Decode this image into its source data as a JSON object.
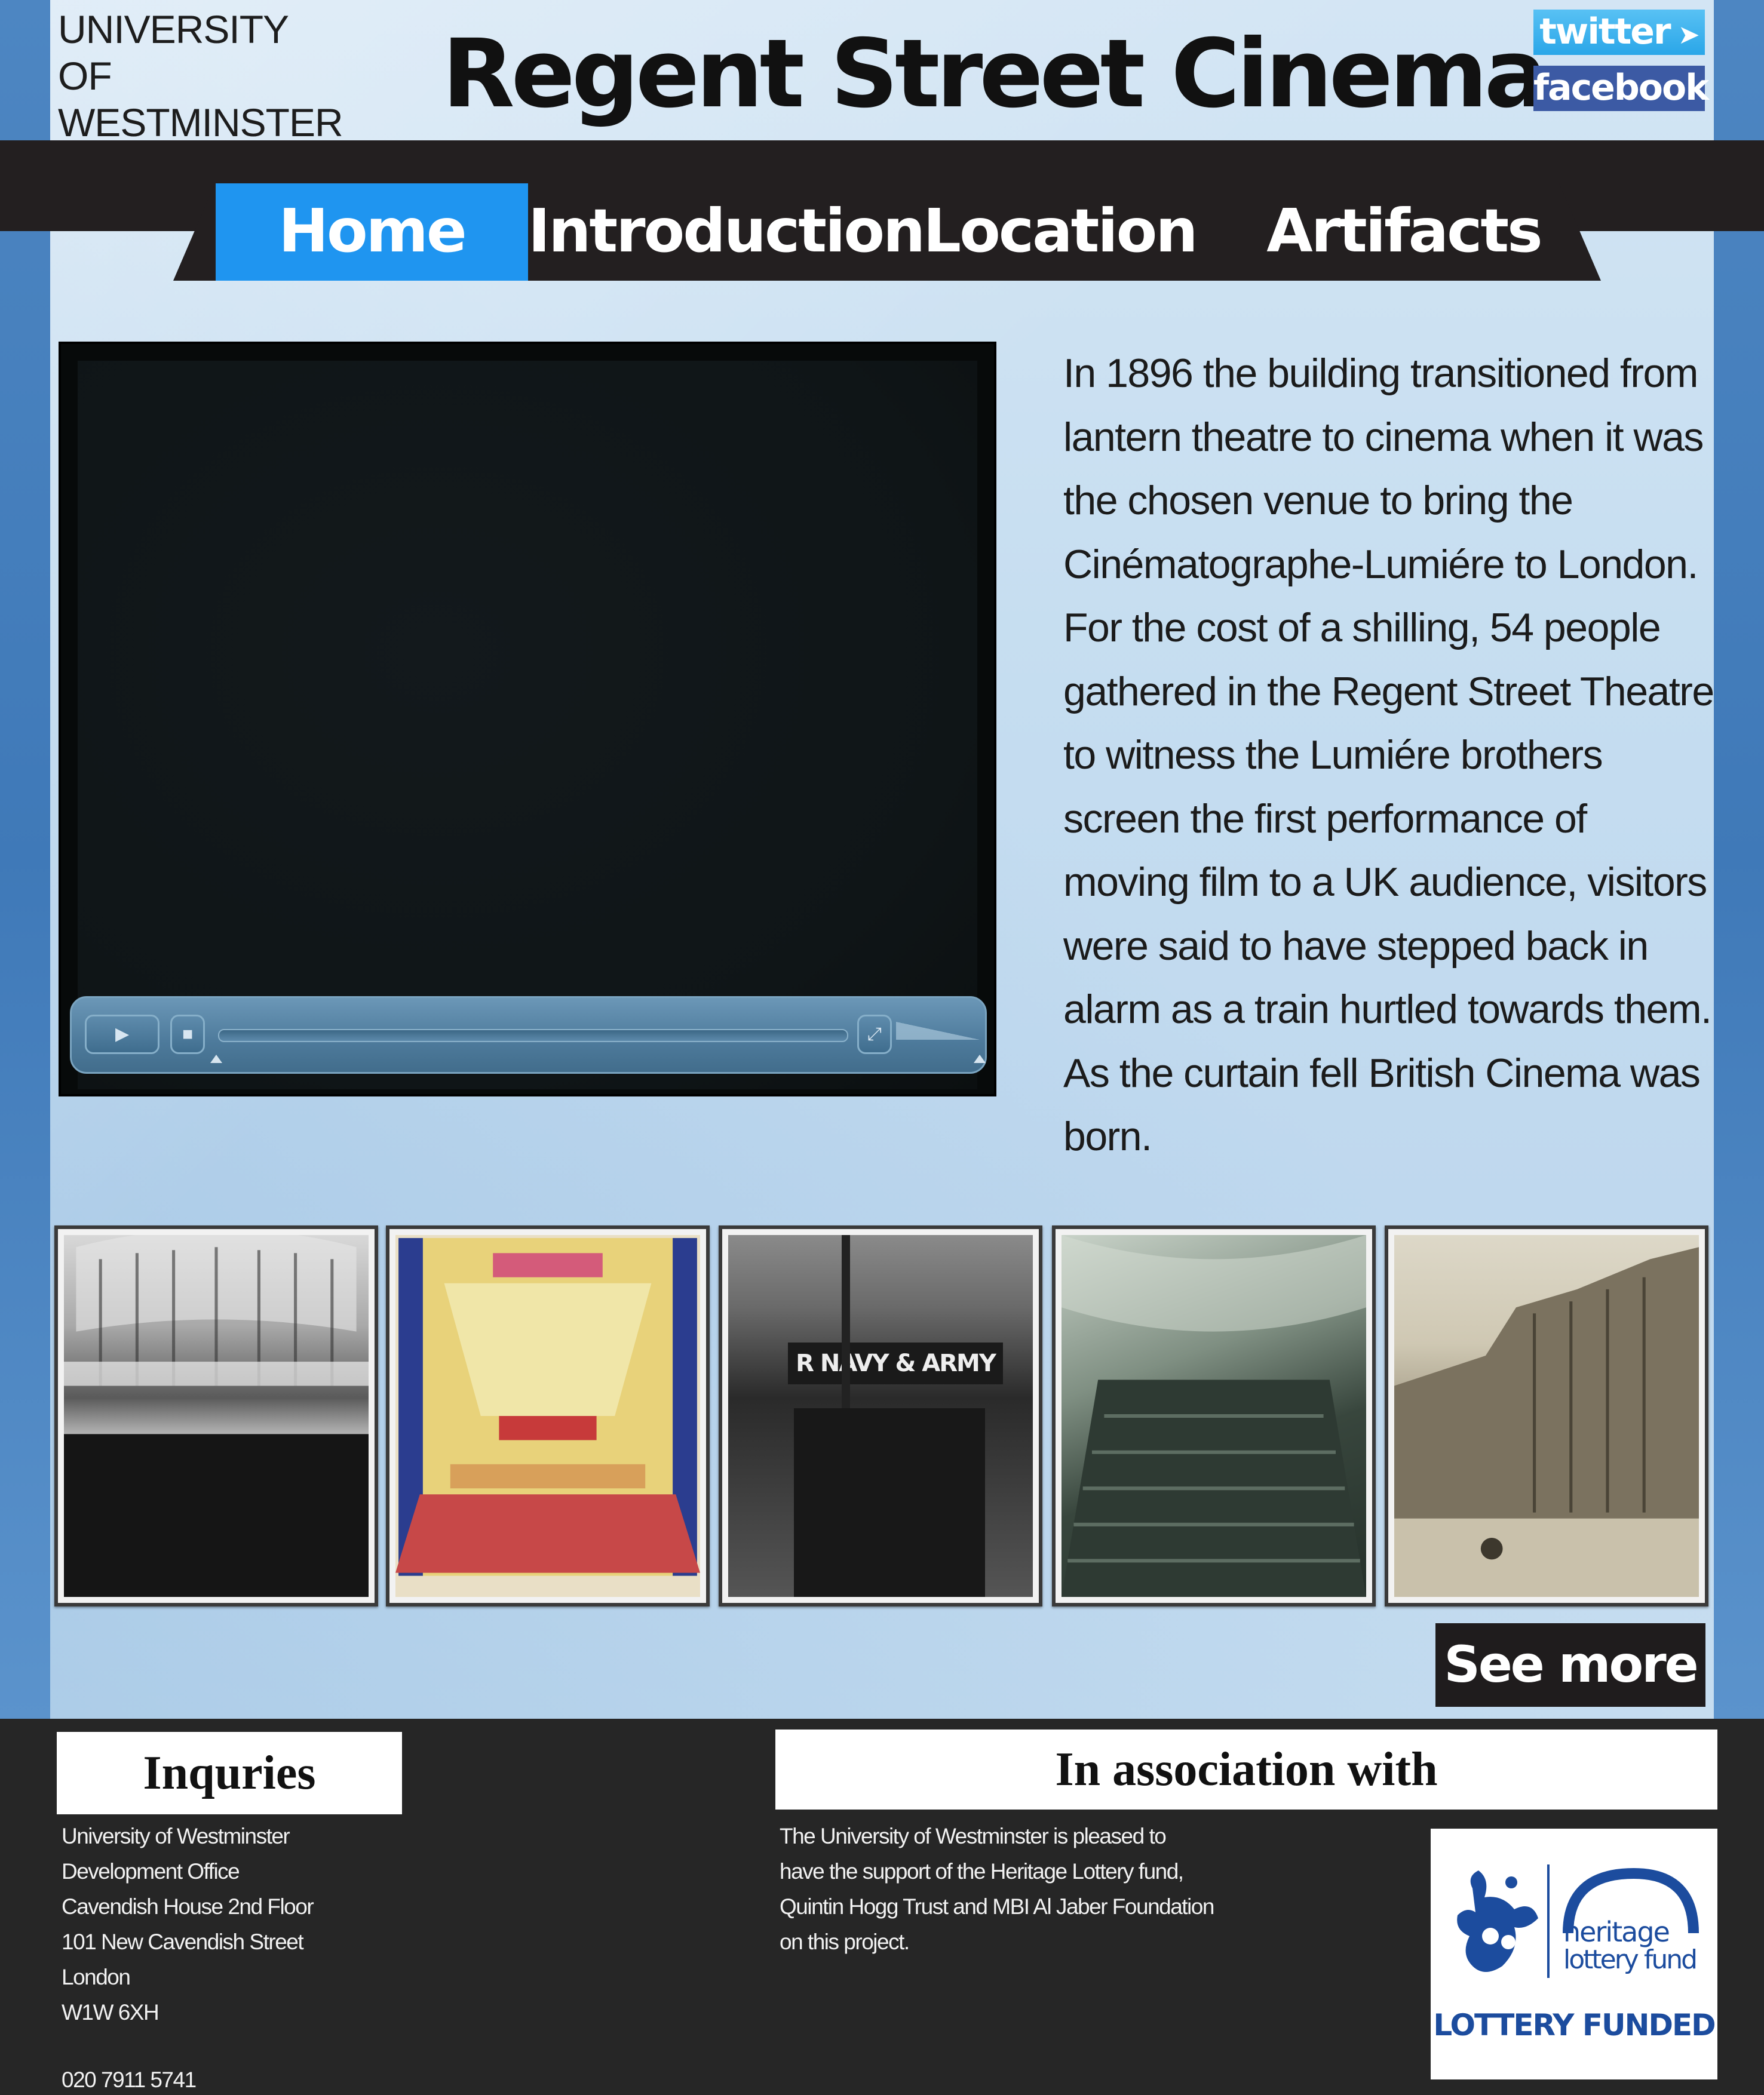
{
  "header": {
    "university_line1": "UNIVERSITY OF",
    "university_line2": "WESTMINSTER",
    "site_title": "Regent Street Cinema",
    "social_twitter": "twitter",
    "social_facebook": "facebook"
  },
  "nav": {
    "items": [
      {
        "label": "Home",
        "active": true
      },
      {
        "label": "Introduction",
        "active": false
      },
      {
        "label": "Location",
        "active": false
      },
      {
        "label": "Artifacts",
        "active": false
      }
    ]
  },
  "main": {
    "intro_lines": [
      "In 1896 the building transitioned from",
      "lantern theatre to cinema when it was",
      "the chosen venue to bring the",
      "Cinématographe-Lumiére to London.",
      "For the cost of a shilling, 54 people",
      "gathered in the Regent Street Theatre",
      "to witness the Lumiére brothers",
      "screen the first performance of",
      "moving film to a UK audience, visitors",
      "were said to have stepped back in",
      "alarm as a train hurtled towards them.",
      "As the curtain fell British Cinema was",
      "born."
    ],
    "video_progress": 0
  },
  "gallery": {
    "thumb3_sign": "R NAVY & ARMY",
    "see_more": "See more >"
  },
  "footer": {
    "inquiries_title": "Inquries",
    "inquiries_lines": [
      "University of Westminster",
      "Development Office",
      "Cavendish House 2nd Floor",
      "101 New Cavendish Street",
      "London",
      "W1W 6XH"
    ],
    "phone": "020 7911 5741",
    "association_title": "In association with",
    "association_lines": [
      "The University of Westminster is pleased to",
      "have the support of the Heritage Lottery fund,",
      "Quintin Hogg Trust and MBI Al Jaber Foundation",
      "on this project."
    ],
    "hlf_word1": "heritage",
    "hlf_word2": "lottery fund",
    "hlf_funded": "LOTTERY FUNDED"
  },
  "colors": {
    "nav_active": "#1f95f0",
    "ribbon": "#231f20",
    "footer_bg": "#262626"
  }
}
